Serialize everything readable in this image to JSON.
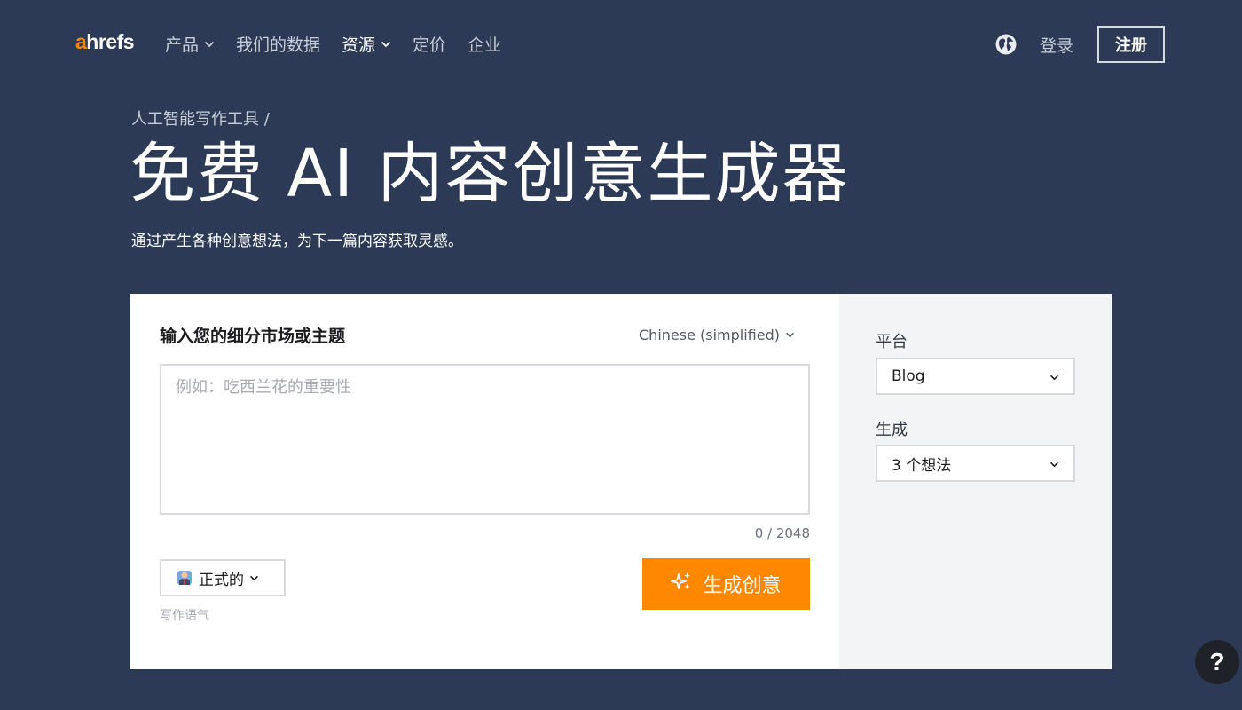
{
  "nav": {
    "logo_a": "a",
    "logo_rest": "hrefs",
    "items": [
      {
        "label": "产品",
        "has_dropdown": true
      },
      {
        "label": "我们的数据",
        "has_dropdown": false
      },
      {
        "label": "资源",
        "has_dropdown": true
      },
      {
        "label": "定价",
        "has_dropdown": false
      },
      {
        "label": "企业",
        "has_dropdown": false
      }
    ],
    "globe_icon": "globe-icon",
    "login_label": "登录",
    "signup_label": "注册"
  },
  "hero": {
    "breadcrumb": "人工智能写作工具 /",
    "title": "免费 AI 内容创意生成器",
    "subtitle": "通过产生各种创意想法，为下一篇内容获取灵感。"
  },
  "form": {
    "topic_label": "输入您的细分市场或主题",
    "language": "Chinese (simplified)",
    "topic_placeholder": "例如：吃西兰花的重要性",
    "topic_value": "",
    "counter": "0 / 2048",
    "tone_value": "正式的",
    "tone_caption": "写作语气",
    "generate_label": "生成创意",
    "platform_label": "平台",
    "platform_value": "Blog",
    "generate_count_label": "生成",
    "generate_count_value": "3 个想法"
  },
  "help_label": "?",
  "colors": {
    "background": "#2c3a56",
    "accent": "#ff8800",
    "side_panel": "#f3f4f6"
  }
}
